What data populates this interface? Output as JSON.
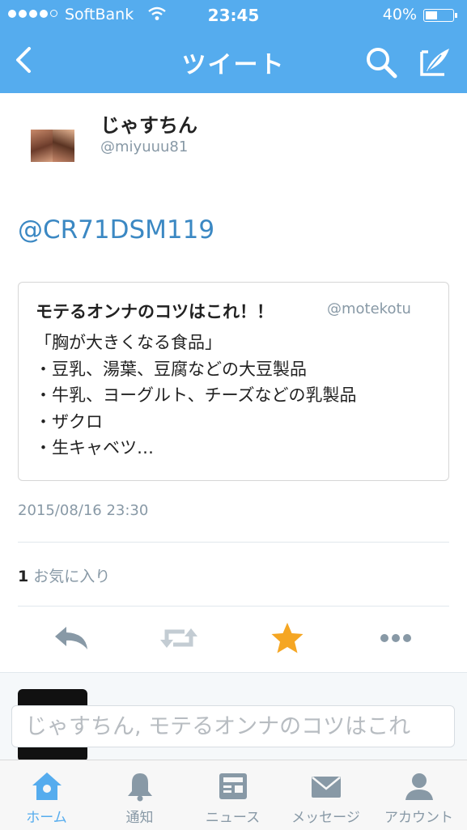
{
  "status_bar": {
    "carrier": "SoftBank",
    "time": "23:45",
    "battery_text": "40%",
    "battery_level": 0.4
  },
  "navbar": {
    "title": "ツイート",
    "icons": [
      "back-chevron-icon",
      "search-icon",
      "compose-tweet-icon"
    ]
  },
  "tweet": {
    "display_name": "じゃすちん",
    "handle": "@miyuuu81",
    "text": "@CR71DSM119",
    "quoted": {
      "title": "モテるオンナのコツはこれ！！",
      "handle": "@motekotu",
      "lines": [
        "「胸が大きくなる食品」",
        "・豆乳、湯葉、豆腐などの大豆製品",
        "・牛乳、ヨーグルト、チーズなどの乳製品",
        "・ザクロ",
        "・生キャベツ…"
      ]
    },
    "timestamp": "2015/08/16 23:30",
    "favorites_count": "1",
    "favorites_label": "お気に入り"
  },
  "actions": {
    "icons": [
      "reply-icon",
      "retweet-icon",
      "favorite-star-icon",
      "more-icon"
    ],
    "favorite_color": "#f5a623"
  },
  "compose": {
    "placeholder": "じゃすちん, モテるオンナのコツはこれ"
  },
  "tabbar": {
    "items": [
      {
        "label": "ホーム",
        "icon": "home-icon",
        "active": true
      },
      {
        "label": "通知",
        "icon": "bell-icon",
        "active": false
      },
      {
        "label": "ニュース",
        "icon": "news-icon",
        "active": false
      },
      {
        "label": "メッセージ",
        "icon": "envelope-icon",
        "active": false
      },
      {
        "label": "アカウント",
        "icon": "person-icon",
        "active": false
      }
    ]
  },
  "colors": {
    "brand": "#55acee",
    "link": "#3b88c3",
    "muted": "#8899a6"
  }
}
